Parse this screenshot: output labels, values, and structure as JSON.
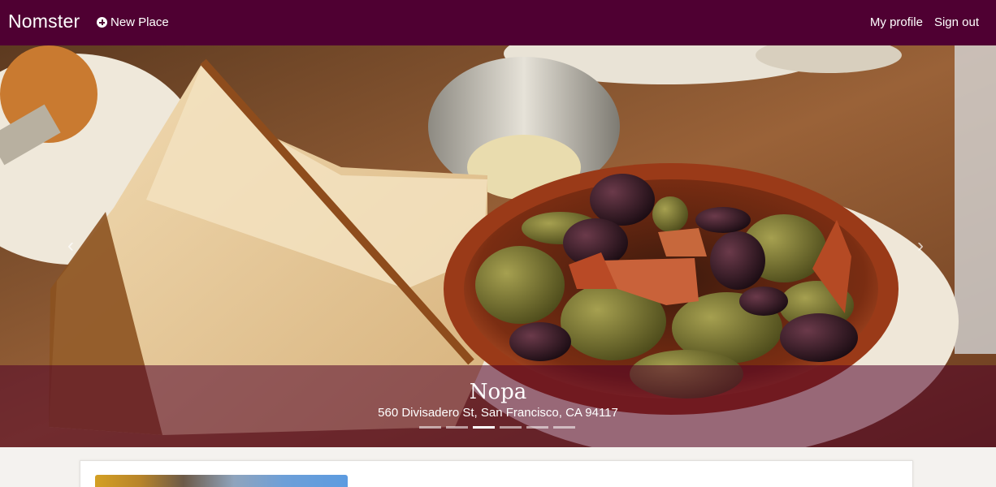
{
  "navbar": {
    "brand": "Nomster",
    "new_place_label": "New Place",
    "my_profile_label": "My profile",
    "sign_out_label": "Sign out",
    "background_color": "#4f0032"
  },
  "carousel": {
    "place_name": "Nopa",
    "place_address": "560 Divisadero St, San Francisco, CA 94117",
    "slide_count": 6,
    "active_slide_index": 2,
    "prev_icon": "chevron-left-icon",
    "next_icon": "chevron-right-icon"
  },
  "content": {
    "thumbnail_icon": "place-photo-thumbnail"
  }
}
